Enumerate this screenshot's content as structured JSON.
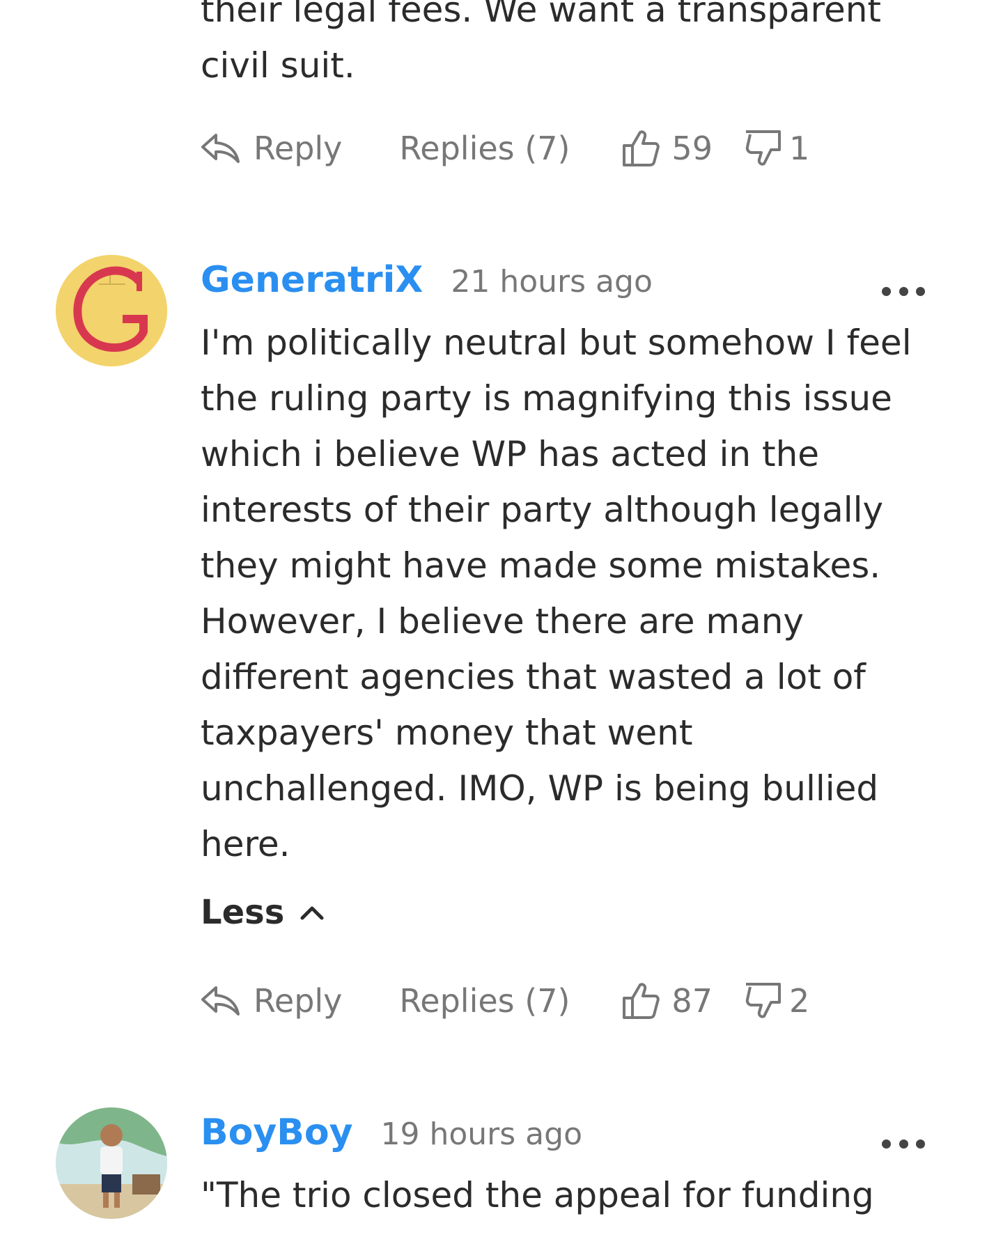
{
  "previous_comment": {
    "text_tail": "their legal fees. We want a transparent\ncivil suit.",
    "actions": {
      "reply_label": "Reply",
      "replies_label": "Replies (7)",
      "likes": "59",
      "dislikes": "1"
    }
  },
  "comments": [
    {
      "author": "GeneratriX",
      "time": "21 hours ago",
      "avatar_letter": "G",
      "body": "I'm politically neutral but somehow I feel the ruling party is magnifying this issue which i believe WP has acted in the interests of their party although legally they might have made some mistakes. However, I believe there are many different agencies that wasted a lot of taxpayers' money that went unchallenged. IMO, WP is being bullied here.",
      "less_label": "Less",
      "actions": {
        "reply_label": "Reply",
        "replies_label": "Replies (7)",
        "likes": "87",
        "dislikes": "2"
      }
    },
    {
      "author": "BoyBoy",
      "time": "19 hours ago",
      "body_start": "\"The trio closed the appeal for funding"
    }
  ],
  "colors": {
    "author": "#2a8ff0",
    "text": "#2b2b2b",
    "muted": "#777777",
    "avatar_g_bg": "#f3d36b",
    "avatar_g_letter": "#d8384f"
  }
}
